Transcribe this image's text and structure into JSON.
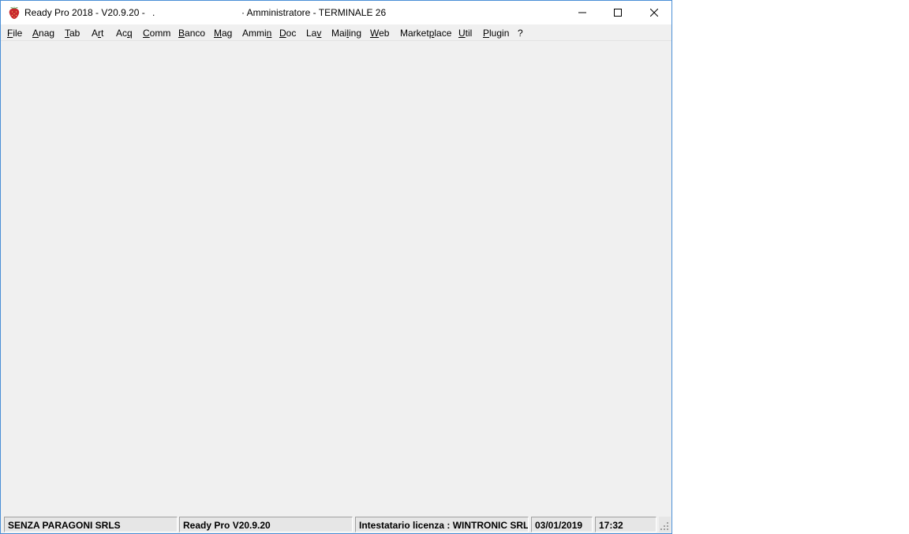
{
  "window": {
    "title_left": "Ready Pro 2018 - V20.9.20 -",
    "title_dot": ".",
    "title_right": "· Amministratore - TERMINALE 26",
    "icon": "strawberry-icon"
  },
  "controls": {
    "minimize_icon": "minimize-icon",
    "maximize_icon": "maximize-icon",
    "close_icon": "close-icon"
  },
  "menu": {
    "items": [
      {
        "pre": "",
        "ul": "F",
        "post": "ile"
      },
      {
        "pre": "",
        "ul": "A",
        "post": "nag"
      },
      {
        "pre": "",
        "ul": "T",
        "post": "ab"
      },
      {
        "pre": "A",
        "ul": "r",
        "post": "t"
      },
      {
        "pre": "Ac",
        "ul": "q",
        "post": ""
      },
      {
        "pre": "",
        "ul": "C",
        "post": "omm"
      },
      {
        "pre": "",
        "ul": "B",
        "post": "anco"
      },
      {
        "pre": "",
        "ul": "M",
        "post": "ag"
      },
      {
        "pre": "Ammi",
        "ul": "n",
        "post": ""
      },
      {
        "pre": "",
        "ul": "D",
        "post": "oc"
      },
      {
        "pre": "La",
        "ul": "v",
        "post": ""
      },
      {
        "pre": "Mai",
        "ul": "l",
        "post": "ing"
      },
      {
        "pre": "",
        "ul": "W",
        "post": "eb"
      },
      {
        "pre": "Market",
        "ul": "p",
        "post": "lace"
      },
      {
        "pre": "",
        "ul": "U",
        "post": "til"
      },
      {
        "pre": "",
        "ul": "P",
        "post": "lugin"
      },
      {
        "pre": "",
        "ul": "?",
        "post": ""
      }
    ]
  },
  "status": {
    "company": "SENZA PARAGONI SRLS",
    "version": "Ready Pro V20.9.20",
    "license": "Intestatario licenza : WINTRONIC SRL",
    "date": "03/01/2019",
    "time": "17:32"
  }
}
